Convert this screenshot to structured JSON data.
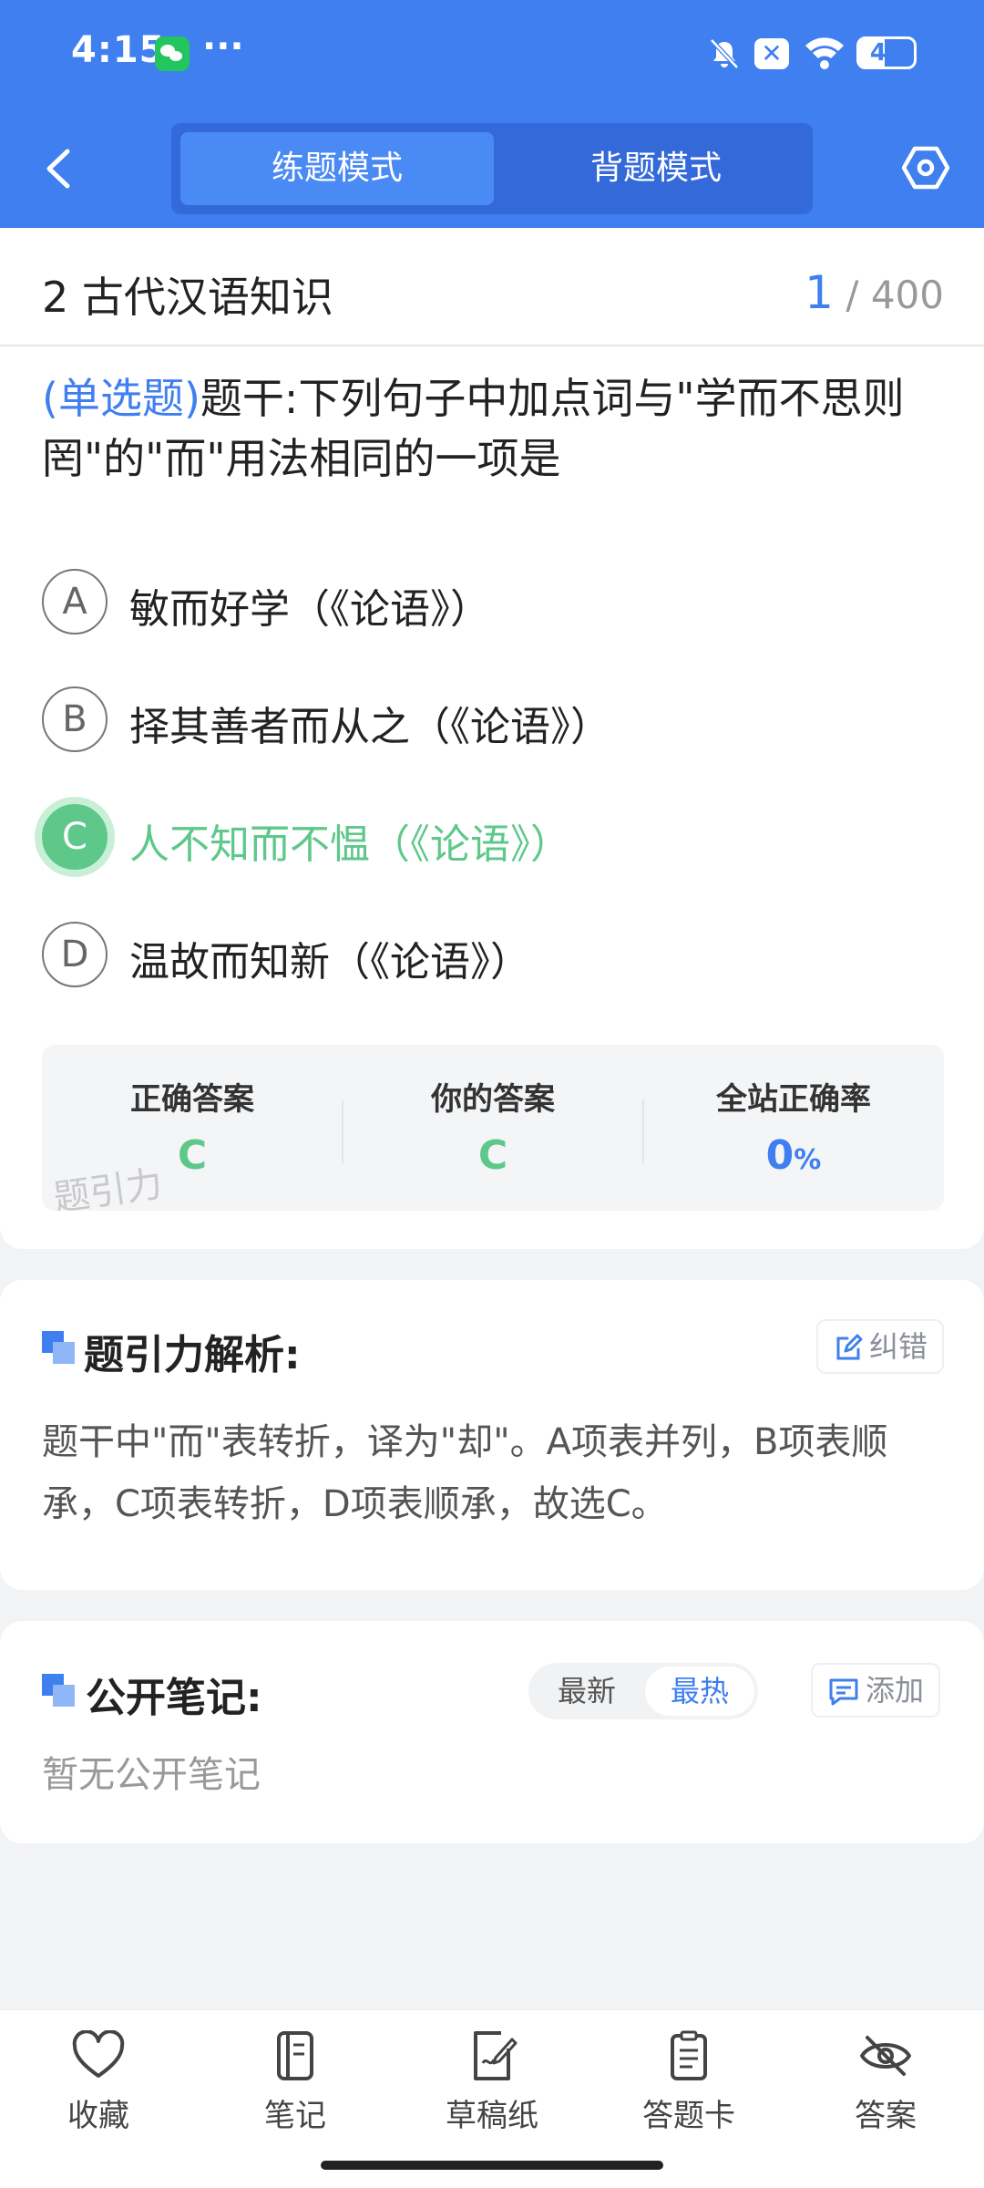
{
  "status_bar": {
    "time": "4:15",
    "more": "···",
    "battery": "46",
    "battery_level": 0.46
  },
  "header": {
    "modes": [
      "练题模式",
      "背题模式"
    ],
    "active_mode": "练题模式"
  },
  "question": {
    "chapter": "2 古代汉语知识",
    "current": "1",
    "total": "/ 400",
    "type_label": "(单选题)",
    "stem": "题干:下列句子中加点词与\"学而不思则罔\"的\"而\"用法相同的一项是",
    "options": [
      {
        "letter": "A",
        "text": "敏而好学（《论语》）"
      },
      {
        "letter": "B",
        "text": "择其善者而从之（《论语》）"
      },
      {
        "letter": "C",
        "text": "人不知而不愠（《论语》）"
      },
      {
        "letter": "D",
        "text": "温故而知新（《论语》）"
      }
    ],
    "selected": "C"
  },
  "stats": {
    "correct_label": "正确答案",
    "correct_value": "C",
    "yours_label": "你的答案",
    "yours_value": "C",
    "rate_label": "全站正确率",
    "rate_value": "0",
    "rate_unit": "%",
    "watermark": "题引力"
  },
  "analysis": {
    "title": "题引力解析:",
    "report_label": "纠错",
    "text": "题干中\"而\"表转折，译为\"却\"。A项表并列，B项表顺承，C项表转折，D项表顺承，故选C。"
  },
  "notes": {
    "title": "公开笔记:",
    "sort_options": [
      "最新",
      "最热"
    ],
    "active_sort": "最热",
    "add_label": "添加",
    "empty_text": "暂无公开笔记"
  },
  "bottom_nav": [
    {
      "label": "收藏",
      "icon": "heart-icon"
    },
    {
      "label": "笔记",
      "icon": "notebook-icon"
    },
    {
      "label": "草稿纸",
      "icon": "draft-icon"
    },
    {
      "label": "答题卡",
      "icon": "clipboard-icon"
    },
    {
      "label": "答案",
      "icon": "eye-off-icon"
    }
  ],
  "colors": {
    "primary": "#3f7ff0",
    "correct": "#5ec88a",
    "header_dark": "#3369d8"
  }
}
